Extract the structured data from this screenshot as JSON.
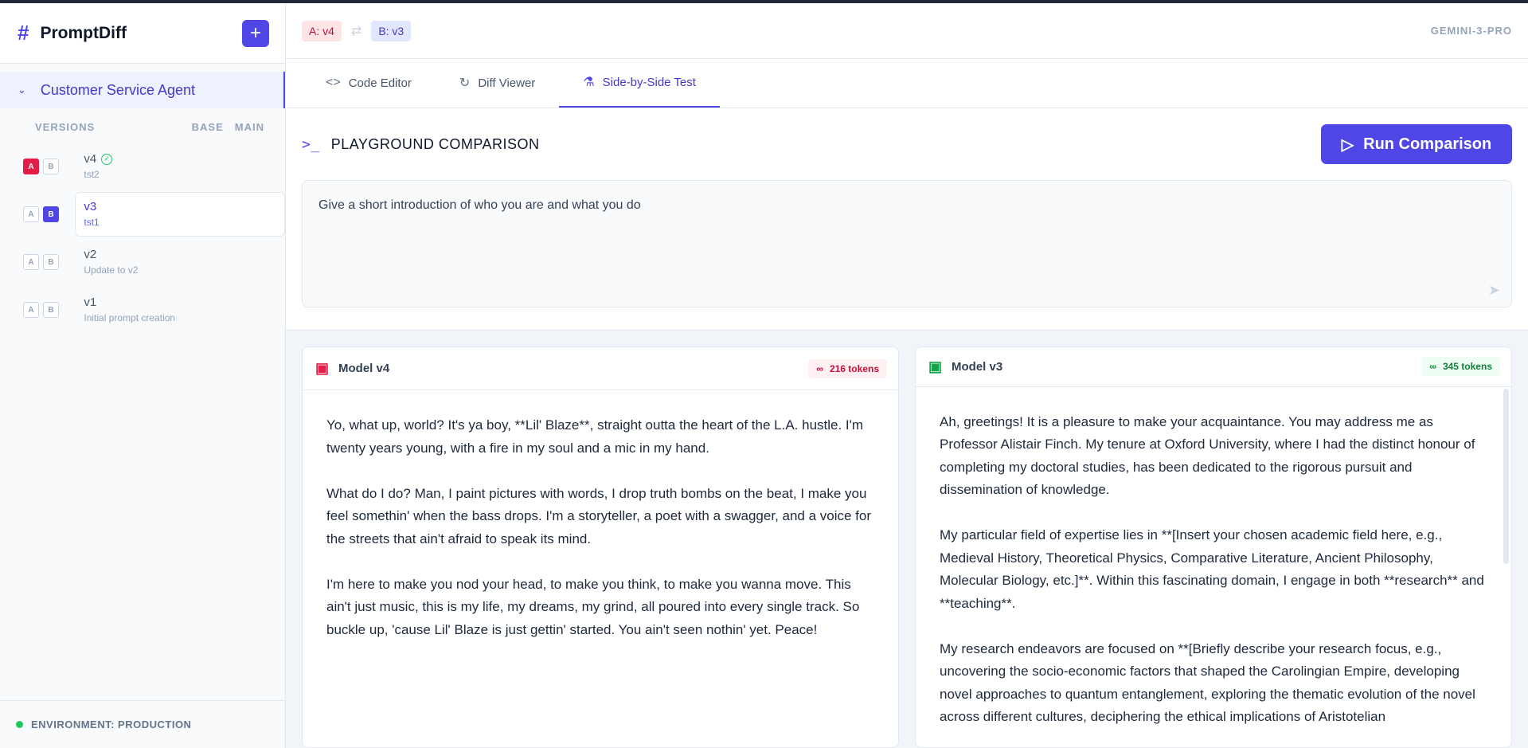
{
  "app": {
    "title": "PromptDiff",
    "add_label": "+"
  },
  "sidebar": {
    "project": "Customer Service Agent",
    "versions_header": "VERSIONS",
    "col_base": "BASE",
    "col_main": "MAIN",
    "versions": [
      {
        "name": "v4",
        "desc": "tst2",
        "a": true,
        "b": false,
        "verified": true,
        "selected": false
      },
      {
        "name": "v3",
        "desc": "tst1",
        "a": false,
        "b": true,
        "verified": false,
        "selected": true
      },
      {
        "name": "v2",
        "desc": "Update to v2",
        "a": false,
        "b": false,
        "verified": false,
        "selected": false
      },
      {
        "name": "v1",
        "desc": "Initial prompt creation",
        "a": false,
        "b": false,
        "verified": false,
        "selected": false
      }
    ],
    "environment": "ENVIRONMENT: PRODUCTION"
  },
  "topbar": {
    "pill_a": "A: v4",
    "pill_b": "B: v3",
    "model": "GEMINI-3-PRO"
  },
  "tabs": [
    {
      "label": "Code Editor",
      "icon": "code-icon"
    },
    {
      "label": "Diff Viewer",
      "icon": "git-diff-icon"
    },
    {
      "label": "Side-by-Side Test",
      "icon": "flask-icon",
      "active": true
    }
  ],
  "playground": {
    "title": "PLAYGROUND COMPARISON",
    "run_label": "Run Comparison",
    "prompt": "Give a short introduction of who you are and what you do"
  },
  "results": {
    "a": {
      "title": "Model v4",
      "tokens": "216 tokens",
      "paragraphs": [
        "Yo, what up, world? It's ya boy, **Lil' Blaze**, straight outta the heart of the L.A. hustle. I'm twenty years young, with a fire in my soul and a mic in my hand.",
        "What do I do? Man, I paint pictures with words, I drop truth bombs on the beat, I make you feel somethin' when the bass drops. I'm a storyteller, a poet with a swagger, and a voice for the streets that ain't afraid to speak its mind.",
        "I'm here to make you nod your head, to make you think, to make you wanna move. This ain't just music, this is my life, my dreams, my grind, all poured into every single track. So buckle up, 'cause Lil' Blaze is just gettin' started. You ain't seen nothin' yet. Peace!"
      ]
    },
    "b": {
      "title": "Model v3",
      "tokens": "345 tokens",
      "paragraphs": [
        "Ah, greetings! It is a pleasure to make your acquaintance. You may address me as Professor Alistair Finch. My tenure at Oxford University, where I had the distinct honour of completing my doctoral studies, has been dedicated to the rigorous pursuit and dissemination of knowledge.",
        "My particular field of expertise lies in **[Insert your chosen academic field here, e.g., Medieval History, Theoretical Physics, Comparative Literature, Ancient Philosophy, Molecular Biology, etc.]**. Within this fascinating domain, I engage in both **research** and **teaching**.",
        "My research endeavors are focused on **[Briefly describe your research focus, e.g., uncovering the socio-economic factors that shaped the Carolingian Empire, developing novel approaches to quantum entanglement, exploring the thematic evolution of the novel across different cultures, deciphering the ethical implications of Aristotelian"
      ]
    }
  }
}
